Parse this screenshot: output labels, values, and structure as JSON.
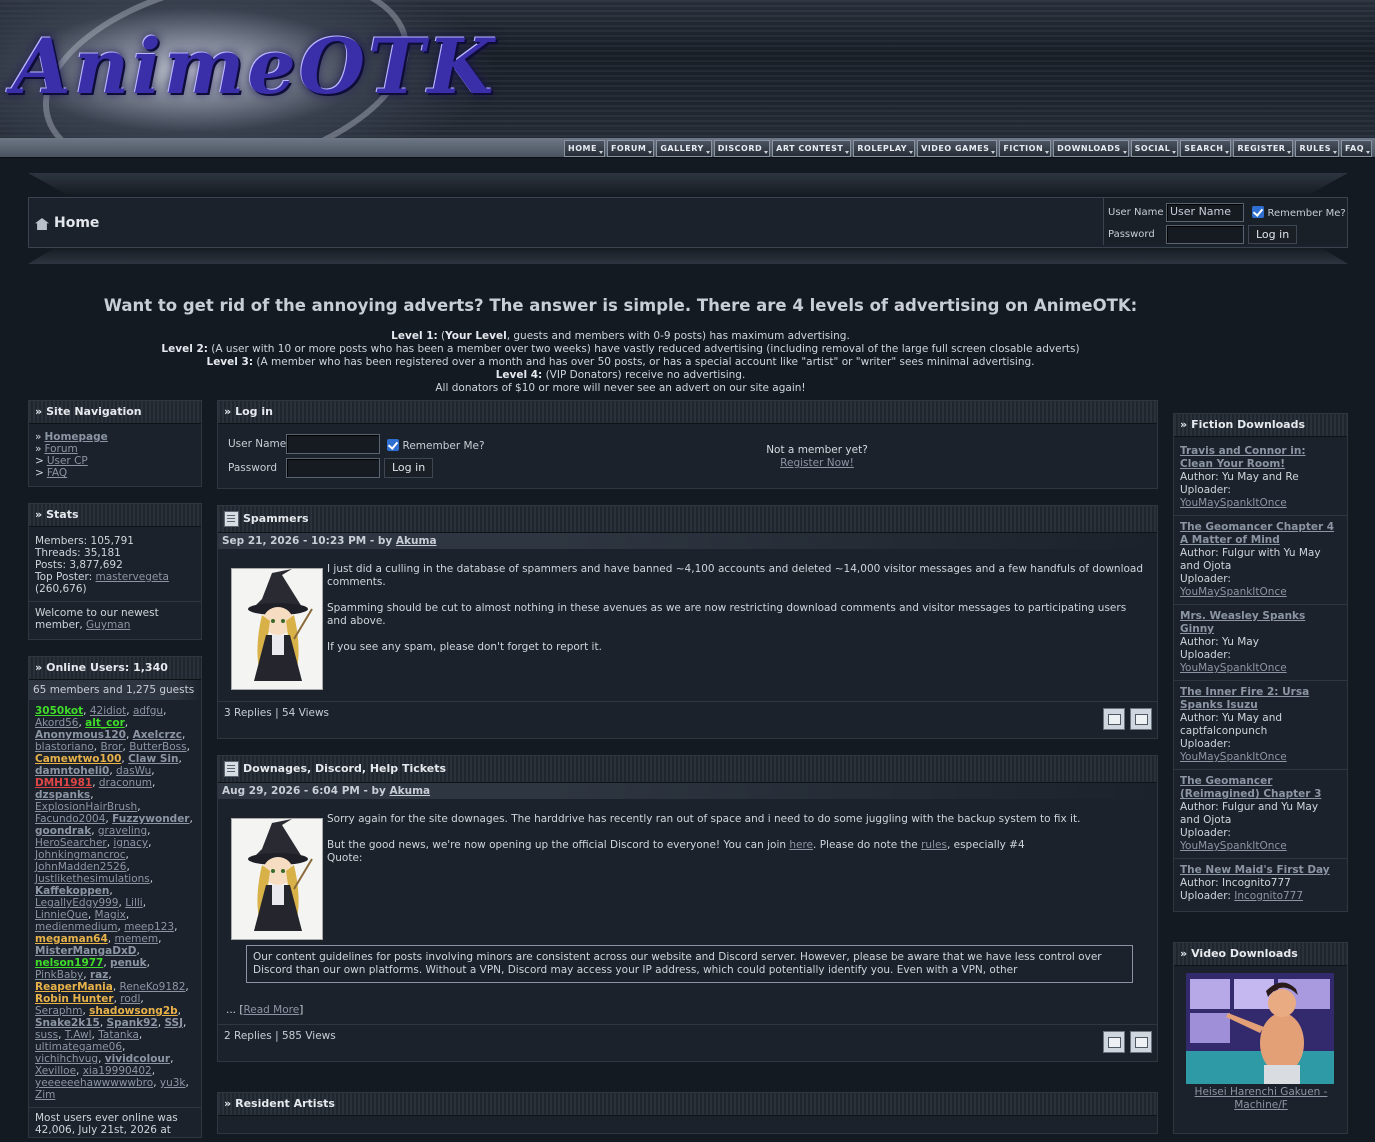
{
  "site": {
    "logo_text": "AnimeOTK"
  },
  "nav": [
    "HOME",
    "FORUM",
    "GALLERY",
    "DISCORD",
    "ART CONTEST",
    "ROLEPLAY",
    "VIDEO GAMES",
    "FICTION",
    "DOWNLOADS",
    "SOCIAL",
    "SEARCH",
    "REGISTER",
    "RULES",
    "FAQ"
  ],
  "header": {
    "title": "Home",
    "login": {
      "username_label": "User Name",
      "username_value": "User Name",
      "password_label": "Password",
      "remember_label": "Remember Me?",
      "login_button": "Log in"
    }
  },
  "notice": {
    "headline": "Want to get rid of the annoying adverts? The answer is simple. There are 4 levels of advertising on AnimeOTK:",
    "l1_label": "Level 1:",
    "l1_text_a": " (",
    "l1_bold": "Your Level",
    "l1_text_b": ", guests and members with 0-9 posts) has maximum advertising.",
    "l2_label": "Level 2:",
    "l2_text": " (A user with 10 or more posts who has been a member over two weeks) have vastly reduced advertising (including removal of the large full screen closable adverts)",
    "l3_label": "Level 3:",
    "l3_text": " (A member who has been registered over a month and has over 50 posts, or has a special account like \"artist\" or \"writer\" sees minimal advertising.",
    "l4_label": "Level 4:",
    "l4_text": " (VIP Donators) receive no advertising.",
    "donors": "All donators of $10 or more will never see an advert on our site again!"
  },
  "site_nav": {
    "title": "Site Navigation",
    "links": [
      {
        "prefix": "»",
        "label": "Homepage",
        "bold": true
      },
      {
        "prefix": "»",
        "label": "Forum",
        "bold": false
      },
      {
        "prefix": ">",
        "label": "User CP",
        "bold": false
      },
      {
        "prefix": ">",
        "label": "FAQ",
        "bold": false
      }
    ]
  },
  "stats": {
    "title": "Stats",
    "members": "Members: 105,791",
    "threads": "Threads: 35,181",
    "posts": "Posts: 3,877,692",
    "top_poster_label": "Top Poster: ",
    "top_poster": "mastervegeta",
    "top_poster_count": "(260,676)",
    "welcome": "Welcome to our newest member, ",
    "newest": "Guyman"
  },
  "online": {
    "title": "Online Users: 1,340",
    "summary": "65 members and 1,275 guests",
    "users": [
      {
        "n": "3050kot",
        "c": "#3fdc2a",
        "b": true
      },
      {
        "n": "42idiot",
        "c": "#8b95a4",
        "b": false
      },
      {
        "n": "adfgu",
        "c": "#8b95a4",
        "b": false
      },
      {
        "n": "Akord56",
        "c": "#8b95a4",
        "b": false
      },
      {
        "n": "alt_cor",
        "c": "#3fdc2a",
        "b": true
      },
      {
        "n": "Anonymous120",
        "c": "#8b95a4",
        "b": true
      },
      {
        "n": "Axelcrzc",
        "c": "#8b95a4",
        "b": true
      },
      {
        "n": "blastoriano",
        "c": "#8b95a4",
        "b": false
      },
      {
        "n": "Bror",
        "c": "#8b95a4",
        "b": false
      },
      {
        "n": "ButterBoss",
        "c": "#8b95a4",
        "b": false
      },
      {
        "n": "Camewtwo100",
        "c": "#e8b24a",
        "b": true
      },
      {
        "n": "Claw Sin",
        "c": "#8b95a4",
        "b": true
      },
      {
        "n": "damntoheli0",
        "c": "#8b95a4",
        "b": true
      },
      {
        "n": "dasWu",
        "c": "#8b95a4",
        "b": false
      },
      {
        "n": "DMH1981",
        "c": "#e04646",
        "b": true
      },
      {
        "n": "draconum",
        "c": "#8b95a4",
        "b": false
      },
      {
        "n": "dzspanks",
        "c": "#8b95a4",
        "b": true
      },
      {
        "n": "ExplosionHairBrush",
        "c": "#8b95a4",
        "b": false
      },
      {
        "n": "Facundo2004",
        "c": "#8b95a4",
        "b": false
      },
      {
        "n": "Fuzzywonder",
        "c": "#8b95a4",
        "b": true
      },
      {
        "n": "goondrak",
        "c": "#8b95a4",
        "b": true
      },
      {
        "n": "graveling",
        "c": "#8b95a4",
        "b": false
      },
      {
        "n": "HeroSearcher",
        "c": "#8b95a4",
        "b": false
      },
      {
        "n": "ignacy",
        "c": "#8b95a4",
        "b": false
      },
      {
        "n": "Johnkingmancroc",
        "c": "#8b95a4",
        "b": false
      },
      {
        "n": "JohnMadden2526",
        "c": "#8b95a4",
        "b": false
      },
      {
        "n": "Justlikethesimulations",
        "c": "#8b95a4",
        "b": false
      },
      {
        "n": "Kaffekoppen",
        "c": "#8b95a4",
        "b": true
      },
      {
        "n": "LegallyEdgy999",
        "c": "#8b95a4",
        "b": false
      },
      {
        "n": "Lilli",
        "c": "#8b95a4",
        "b": false
      },
      {
        "n": "LinnieQue",
        "c": "#8b95a4",
        "b": false
      },
      {
        "n": "Magix",
        "c": "#8b95a4",
        "b": false
      },
      {
        "n": "medienmedium",
        "c": "#8b95a4",
        "b": false
      },
      {
        "n": "meep123",
        "c": "#8b95a4",
        "b": false
      },
      {
        "n": "megaman64",
        "c": "#e8b24a",
        "b": true
      },
      {
        "n": "memem",
        "c": "#8b95a4",
        "b": false
      },
      {
        "n": "MisterMangaDxD",
        "c": "#8b95a4",
        "b": true
      },
      {
        "n": "nelson1977",
        "c": "#3fdc2a",
        "b": true
      },
      {
        "n": "penuk",
        "c": "#8b95a4",
        "b": true
      },
      {
        "n": "PinkBaby",
        "c": "#8b95a4",
        "b": false
      },
      {
        "n": "raz",
        "c": "#8b95a4",
        "b": true
      },
      {
        "n": "ReaperMania",
        "c": "#e8b24a",
        "b": true
      },
      {
        "n": "ReneKo9182",
        "c": "#8b95a4",
        "b": false
      },
      {
        "n": "Robin Hunter",
        "c": "#e8b24a",
        "b": true
      },
      {
        "n": "rodl",
        "c": "#8b95a4",
        "b": false
      },
      {
        "n": "Seraphm",
        "c": "#8b95a4",
        "b": false
      },
      {
        "n": "shadowsong2b",
        "c": "#e8b24a",
        "b": true
      },
      {
        "n": "Snake2k15",
        "c": "#8b95a4",
        "b": true
      },
      {
        "n": "Spank92",
        "c": "#8b95a4",
        "b": true
      },
      {
        "n": "SSJ",
        "c": "#8b95a4",
        "b": true
      },
      {
        "n": "suss",
        "c": "#8b95a4",
        "b": false
      },
      {
        "n": "T.Awl",
        "c": "#8b95a4",
        "b": false
      },
      {
        "n": "Tatanka",
        "c": "#8b95a4",
        "b": false
      },
      {
        "n": "ultimategame06",
        "c": "#8b95a4",
        "b": false
      },
      {
        "n": "vichihchvug",
        "c": "#8b95a4",
        "b": false
      },
      {
        "n": "vividcolour",
        "c": "#8b95a4",
        "b": true
      },
      {
        "n": "Xevilloe",
        "c": "#8b95a4",
        "b": false
      },
      {
        "n": "xia19990402",
        "c": "#8b95a4",
        "b": false
      },
      {
        "n": "yeeeeeehawwwwwbro",
        "c": "#8b95a4",
        "b": false
      },
      {
        "n": "yu3k",
        "c": "#8b95a4",
        "b": false
      },
      {
        "n": "Zim",
        "c": "#8b95a4",
        "b": false
      }
    ],
    "most_ever": "Most users ever online was 42,006, July 21st, 2026 at"
  },
  "login_block": {
    "title": "Log in",
    "username_label": "User Name",
    "password_label": "Password",
    "remember_label": "Remember Me?",
    "login_button": "Log in",
    "not_member": "Not a member yet?",
    "register": "Register Now!"
  },
  "posts": [
    {
      "title": "Spammers",
      "date": "Sep 21, 2026 - 10:23 PM - by ",
      "author": "Akuma",
      "p1": "I just did a culling in the database of spammers and have banned ~4,100 accounts and deleted ~14,000 visitor messages and a few handfuls of download comments.",
      "p2": "Spamming should be cut to almost nothing in these avenues as we are now restricting download comments and visitor messages to participating users and above.",
      "p3": "If you see any spam, please don't forget to report it.",
      "footer": "3 Replies | 54 Views"
    },
    {
      "title": "Downages, Discord, Help Tickets",
      "date": "Aug 29, 2026 - 6:04 PM - by ",
      "author": "Akuma",
      "p1": "Sorry again for the site downages. The harddrive has recently ran out of space and i need to do some juggling with the backup system to fix it.",
      "p2a": "But the good news, we're now opening up the official Discord to everyone! You can join ",
      "p2_link1": "here",
      "p2b": ". Please do note the ",
      "p2_link2": "rules",
      "p2c": ", especially #4",
      "quote_label": "Quote:",
      "quote": "Our content guidelines for posts involving minors are consistent across our website and Discord server. However, please be aware that we have less control over Discord than our own platforms. Without a VPN, Discord may access your IP address, which could potentially identify you. Even with a VPN, other",
      "more_prefix": "... [",
      "more_link": "Read More",
      "more_suffix": "]",
      "footer": "2 Replies | 585 Views"
    }
  ],
  "resident_artists": {
    "title": "Resident Artists"
  },
  "fiction": {
    "title": "Fiction Downloads",
    "items": [
      {
        "title": "Travis and Connor in: Clean Your Room!",
        "author": "Author: Yu May and Re",
        "uploader_label": "Uploader:",
        "uploader": "YouMaySpankItOnce"
      },
      {
        "title": "The Geomancer Chapter 4 A Matter of Mind",
        "author": "Author: Fulgur with Yu May and Ojota",
        "uploader_label": "Uploader:",
        "uploader": "YouMaySpankItOnce"
      },
      {
        "title": "Mrs. Weasley Spanks Ginny",
        "author": "Author: Yu May",
        "uploader_label": "Uploader:",
        "uploader": "YouMaySpankItOnce"
      },
      {
        "title": "The Inner Fire 2: Ursa Spanks Isuzu",
        "author": "Author: Yu May and captfalconpunch",
        "uploader_label": "Uploader:",
        "uploader": "YouMaySpankItOnce"
      },
      {
        "title": "The Geomancer (Reimagined) Chapter 3",
        "author": "Author: Fulgur and Yu May and Ojota",
        "uploader_label": "Uploader:",
        "uploader": "YouMaySpankItOnce"
      },
      {
        "title": "The New Maid's First Day",
        "author": "Author: Incognito777",
        "uploader_label": "Uploader: ",
        "uploader": "Incognito777"
      }
    ]
  },
  "video": {
    "title": "Video Downloads",
    "item_title": "Heisei Harenchi Gakuen - Machine/F"
  },
  "colors": {
    "accent_link": "#8b95a4",
    "bg": "#141a22",
    "panel": "#1c222b"
  }
}
